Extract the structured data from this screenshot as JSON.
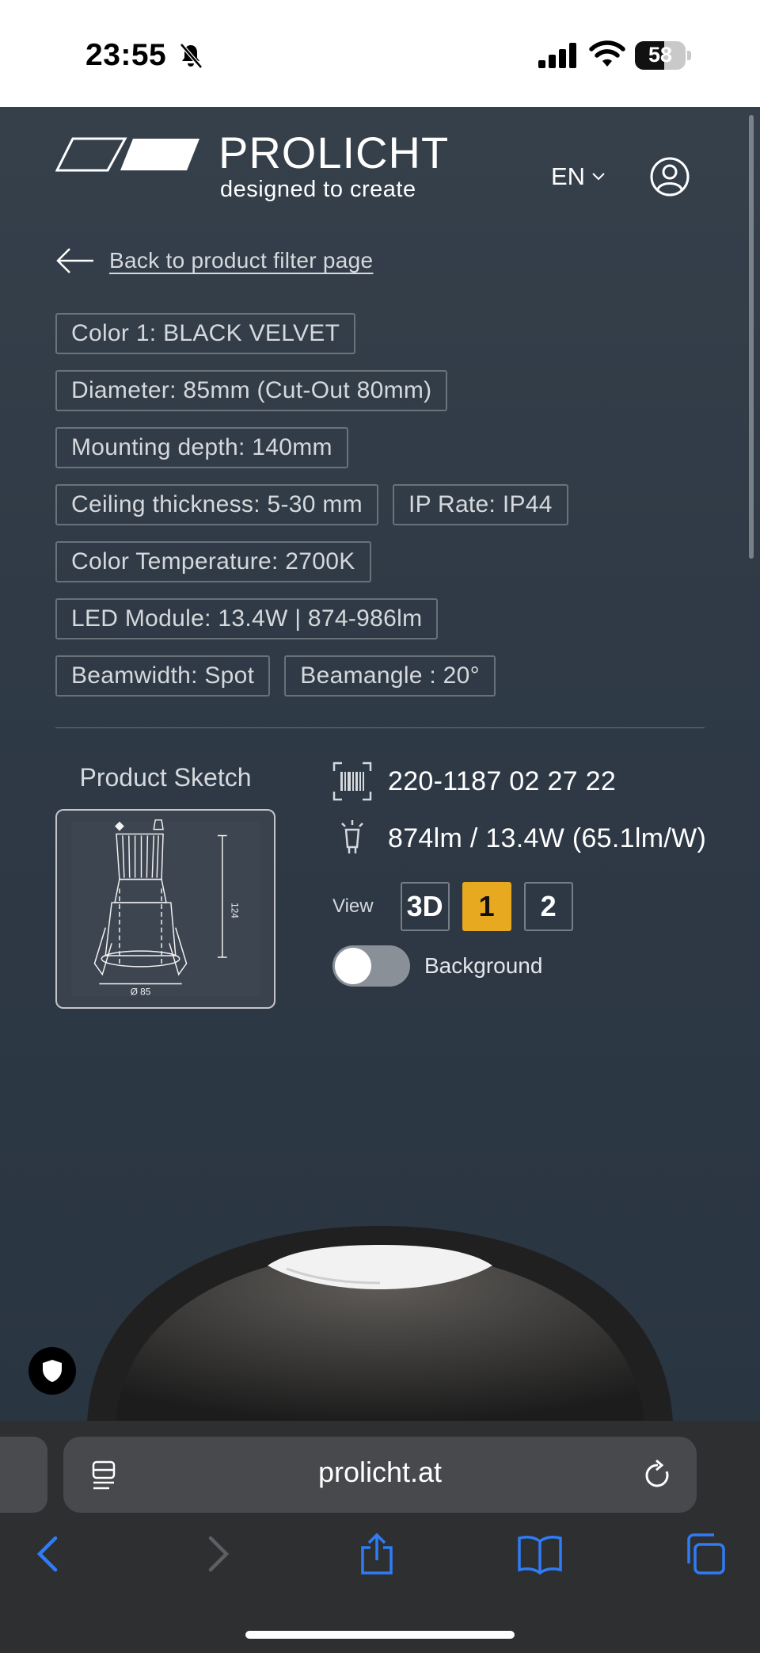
{
  "status_bar": {
    "time": "23:55",
    "battery_level": "58",
    "battery_percent": 58,
    "icons": [
      "bell-muted-icon",
      "cellular-signal-icon",
      "wifi-icon",
      "battery-icon"
    ]
  },
  "header": {
    "brand_name": "PROLICHT",
    "tagline": "designed to create",
    "language": "EN",
    "icons": [
      "chevron-down-icon",
      "user-account-icon"
    ]
  },
  "back_link": "Back to product filter page",
  "spec_tags": [
    [
      "Color 1: BLACK VELVET"
    ],
    [
      "Diameter: 85mm (Cut-Out 80mm)"
    ],
    [
      "Mounting depth: 140mm"
    ],
    [
      "Ceiling thickness: 5-30 mm",
      "IP Rate: IP44"
    ],
    [
      "Color Temperature: 2700K"
    ],
    [
      "LED Module: 13.4W | 874-986lm"
    ],
    [
      "Beamwidth: Spot",
      "Beamangle : 20°"
    ]
  ],
  "sketch": {
    "title": "Product Sketch",
    "height_label": "124",
    "diameter_label": "Ø 85"
  },
  "product": {
    "article_number": "220-1187 02 27 22",
    "efficiency": "874lm / 13.4W (65.1lm/W)",
    "icons": [
      "barcode-icon",
      "lightbulb-icon"
    ]
  },
  "view": {
    "label": "View",
    "options": [
      "3D",
      "1",
      "2"
    ],
    "selected": "1"
  },
  "background_toggle": {
    "label": "Background",
    "on": false
  },
  "browser": {
    "url": "prolicht.at",
    "icons": [
      "reader-icon",
      "reload-icon",
      "back-arrow-icon",
      "forward-arrow-icon",
      "share-icon",
      "bookmarks-icon",
      "tabs-icon",
      "shield-icon"
    ]
  },
  "colors": {
    "accent": "#e7a91f",
    "background": "#2f3944",
    "ios_blue": "#2f7cf6"
  }
}
